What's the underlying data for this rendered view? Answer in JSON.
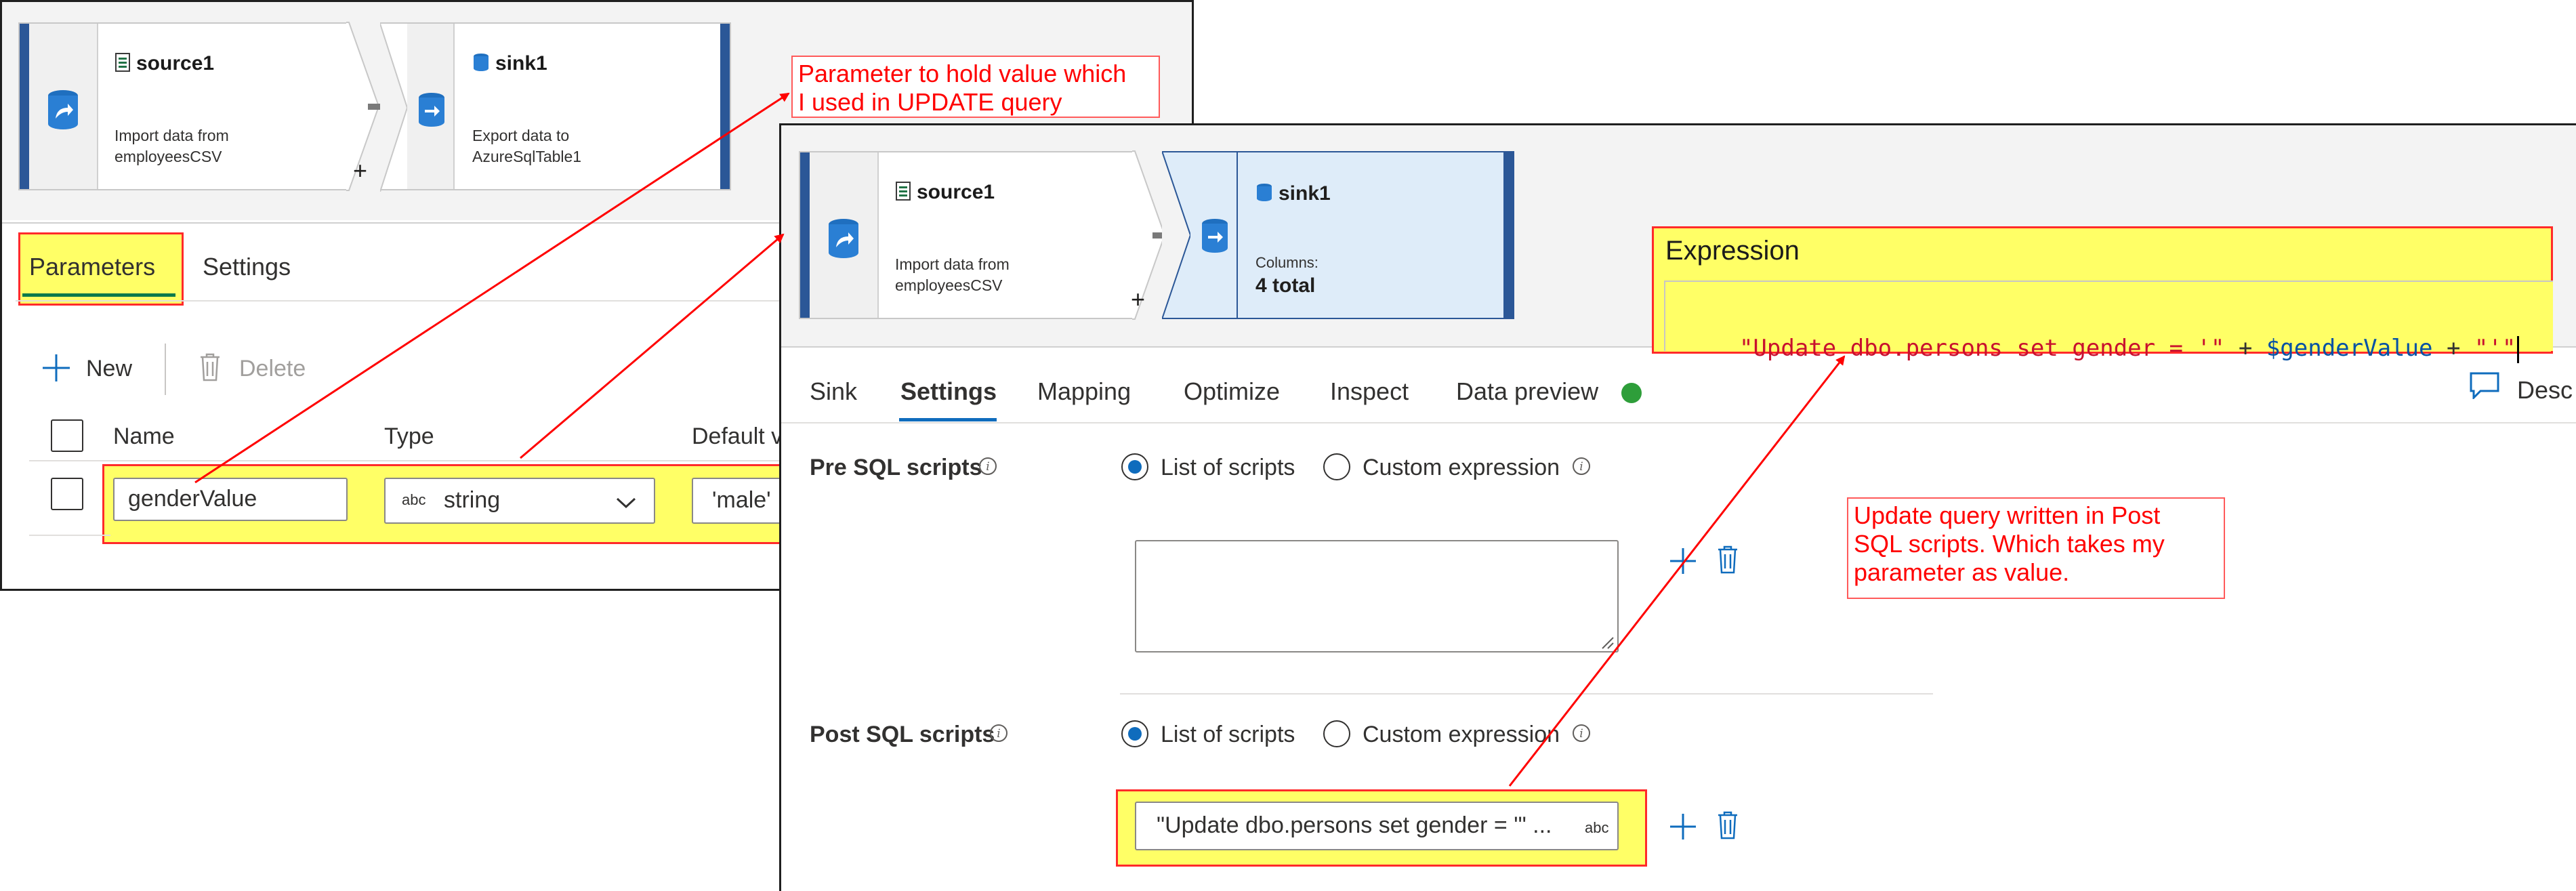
{
  "back_panel": {
    "nodes": {
      "source": {
        "title": "source1",
        "desc": "Import data from\nemployeesCSV",
        "icon": "source-dataset-icon"
      },
      "sink": {
        "title": "sink1",
        "desc": "Export data to\nAzureSqlTable1",
        "icon": "sql-database-icon"
      },
      "add_symbol": "+"
    },
    "tabs": [
      "Parameters",
      "Settings"
    ],
    "toolbar": {
      "new_label": "New",
      "delete_label": "Delete"
    },
    "table": {
      "headers": [
        "Name",
        "Type",
        "Default v"
      ],
      "rows": [
        {
          "name": "genderValue",
          "type_badge": "abc",
          "type": "string",
          "default": "'male'"
        }
      ]
    }
  },
  "front_panel": {
    "nodes": {
      "source": {
        "title": "source1",
        "desc": "Import data from\nemployeesCSV"
      },
      "sink": {
        "title": "sink1",
        "columns_label": "Columns:",
        "columns_value": "4 total"
      },
      "add_symbol": "+"
    },
    "tabs": [
      "Sink",
      "Settings",
      "Mapping",
      "Optimize",
      "Inspect",
      "Data preview"
    ],
    "active_tab": "Settings",
    "status_color": "#2e9e3a",
    "description_label": "Desc",
    "pre_sql": {
      "label": "Pre SQL scripts",
      "options": [
        "List of scripts",
        "Custom expression"
      ],
      "selected": "List of scripts",
      "value": ""
    },
    "post_sql": {
      "label": "Post SQL scripts",
      "options": [
        "List of scripts",
        "Custom expression"
      ],
      "selected": "List of scripts",
      "value": "\"Update dbo.persons set gender = '\" ...",
      "badge": "abc"
    }
  },
  "expression": {
    "title": "Expression",
    "code": {
      "part1": "\"Update dbo.persons set gender = '\"",
      "op1": " + ",
      "var": "$genderValue",
      "op2": " + ",
      "part2": "\"'\""
    }
  },
  "annotations": {
    "parameter": "Parameter to hold value which\nI used in UPDATE query",
    "update_query": "Update query written in Post\nSQL scripts. Which takes my\nparameter as value."
  },
  "colors": {
    "highlight": "#ffff66",
    "annotation_red": "#ff0000",
    "accent_blue": "#0f6cbd",
    "sink_selected_bg": "#deecf9",
    "string_red": "#c8102e",
    "variable_blue": "#0451a5"
  }
}
